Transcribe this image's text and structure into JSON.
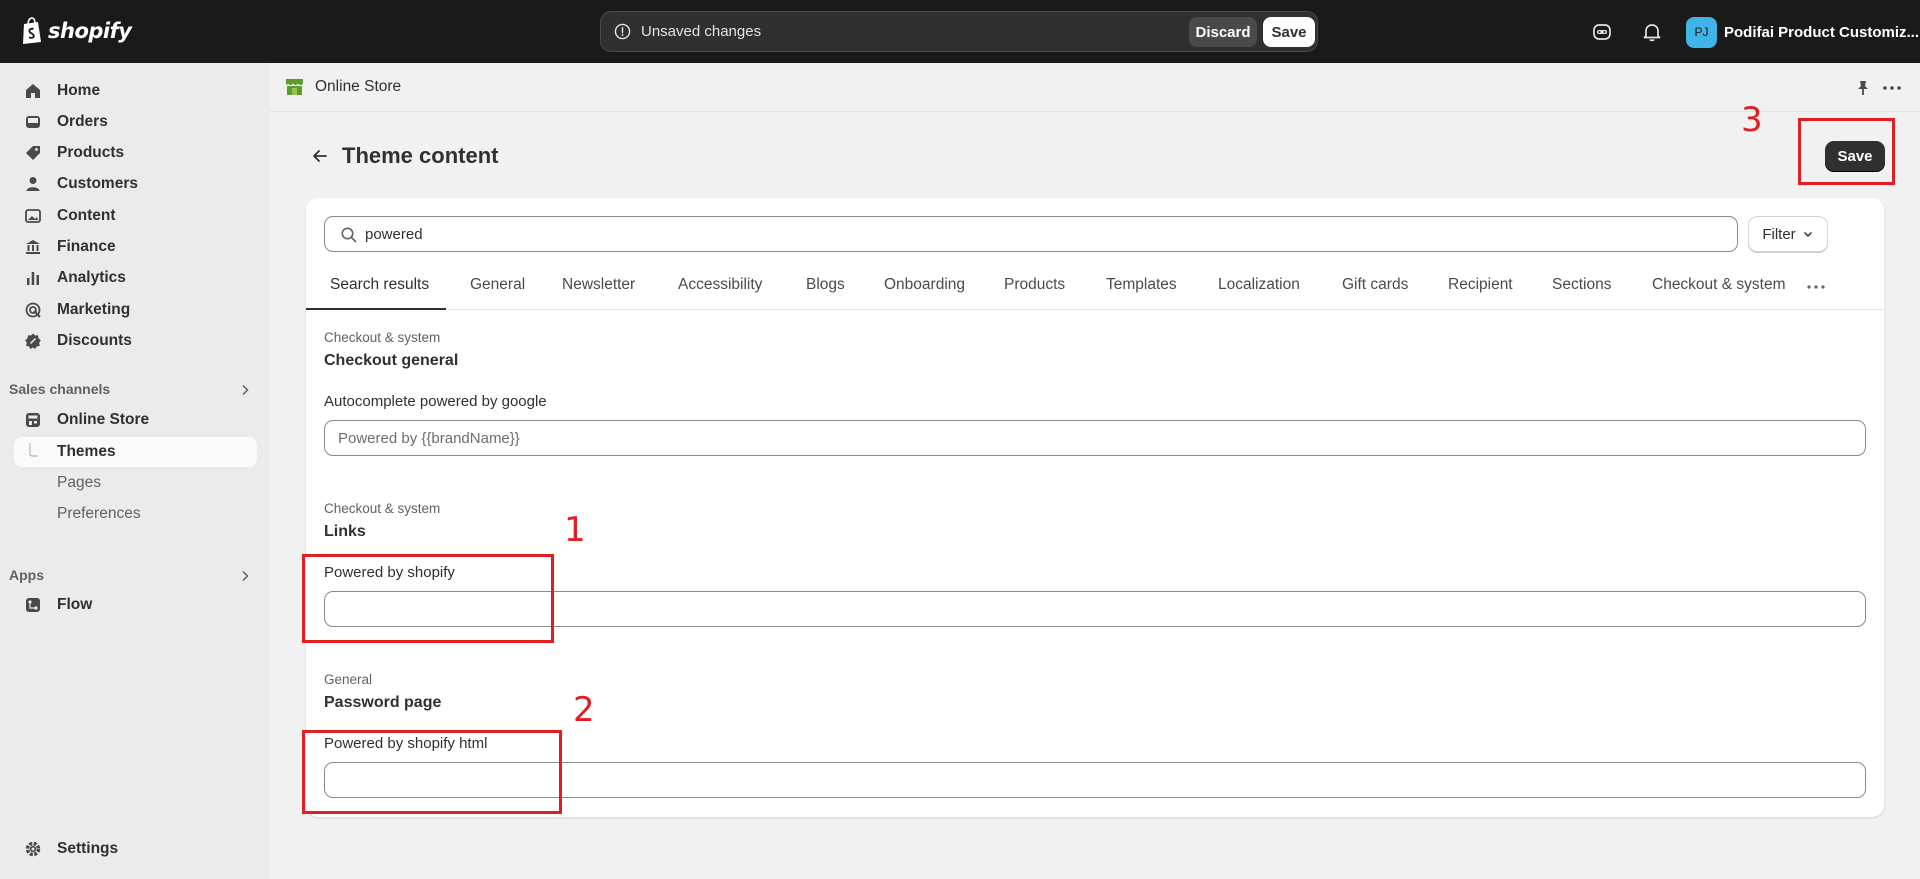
{
  "brand": {
    "logo_text": "shopify"
  },
  "topbar": {
    "unsaved_text": "Unsaved changes",
    "discard_label": "Discard",
    "save_label": "Save",
    "avatar_initials": "PJ",
    "store_name": "Podifai Product Customiz..."
  },
  "sidebar": {
    "items": [
      {
        "label": "Home",
        "icon": "home-icon"
      },
      {
        "label": "Orders",
        "icon": "inbox-icon"
      },
      {
        "label": "Products",
        "icon": "tag-icon"
      },
      {
        "label": "Customers",
        "icon": "person-icon"
      },
      {
        "label": "Content",
        "icon": "image-icon"
      },
      {
        "label": "Finance",
        "icon": "bank-icon"
      },
      {
        "label": "Analytics",
        "icon": "bar-chart-icon"
      },
      {
        "label": "Marketing",
        "icon": "target-icon"
      },
      {
        "label": "Discounts",
        "icon": "discount-icon"
      }
    ],
    "sales_channels_label": "Sales channels",
    "online_store_label": "Online Store",
    "themes_label": "Themes",
    "pages_label": "Pages",
    "preferences_label": "Preferences",
    "apps_label": "Apps",
    "flow_label": "Flow",
    "settings_label": "Settings"
  },
  "main": {
    "breadcrumb": "Online Store",
    "title": "Theme content",
    "save_label": "Save",
    "search": {
      "value": "powered"
    },
    "filter_label": "Filter",
    "tabs": [
      "Search results",
      "General",
      "Newsletter",
      "Accessibility",
      "Blogs",
      "Onboarding",
      "Products",
      "Templates",
      "Localization",
      "Gift cards",
      "Recipient",
      "Sections",
      "Checkout & system"
    ],
    "groups": [
      {
        "category": "Checkout & system",
        "title": "Checkout general",
        "field_label": "Autocomplete powered by google",
        "placeholder": "Powered by {{brandName}}",
        "value": ""
      },
      {
        "category": "Checkout & system",
        "title": "Links",
        "field_label": "Powered by shopify",
        "placeholder": "",
        "value": ""
      },
      {
        "category": "General",
        "title": "Password page",
        "field_label": "Powered by shopify html",
        "placeholder": "",
        "value": ""
      }
    ]
  },
  "annotations": {
    "n1": "1",
    "n2": "2",
    "n3": "3",
    "color": "#e21d24"
  },
  "colors": {
    "topbar": "#1a1a1a",
    "sidebar": "#ebebeb",
    "primary_button": "#303030",
    "avatar": "#40b3e8"
  }
}
